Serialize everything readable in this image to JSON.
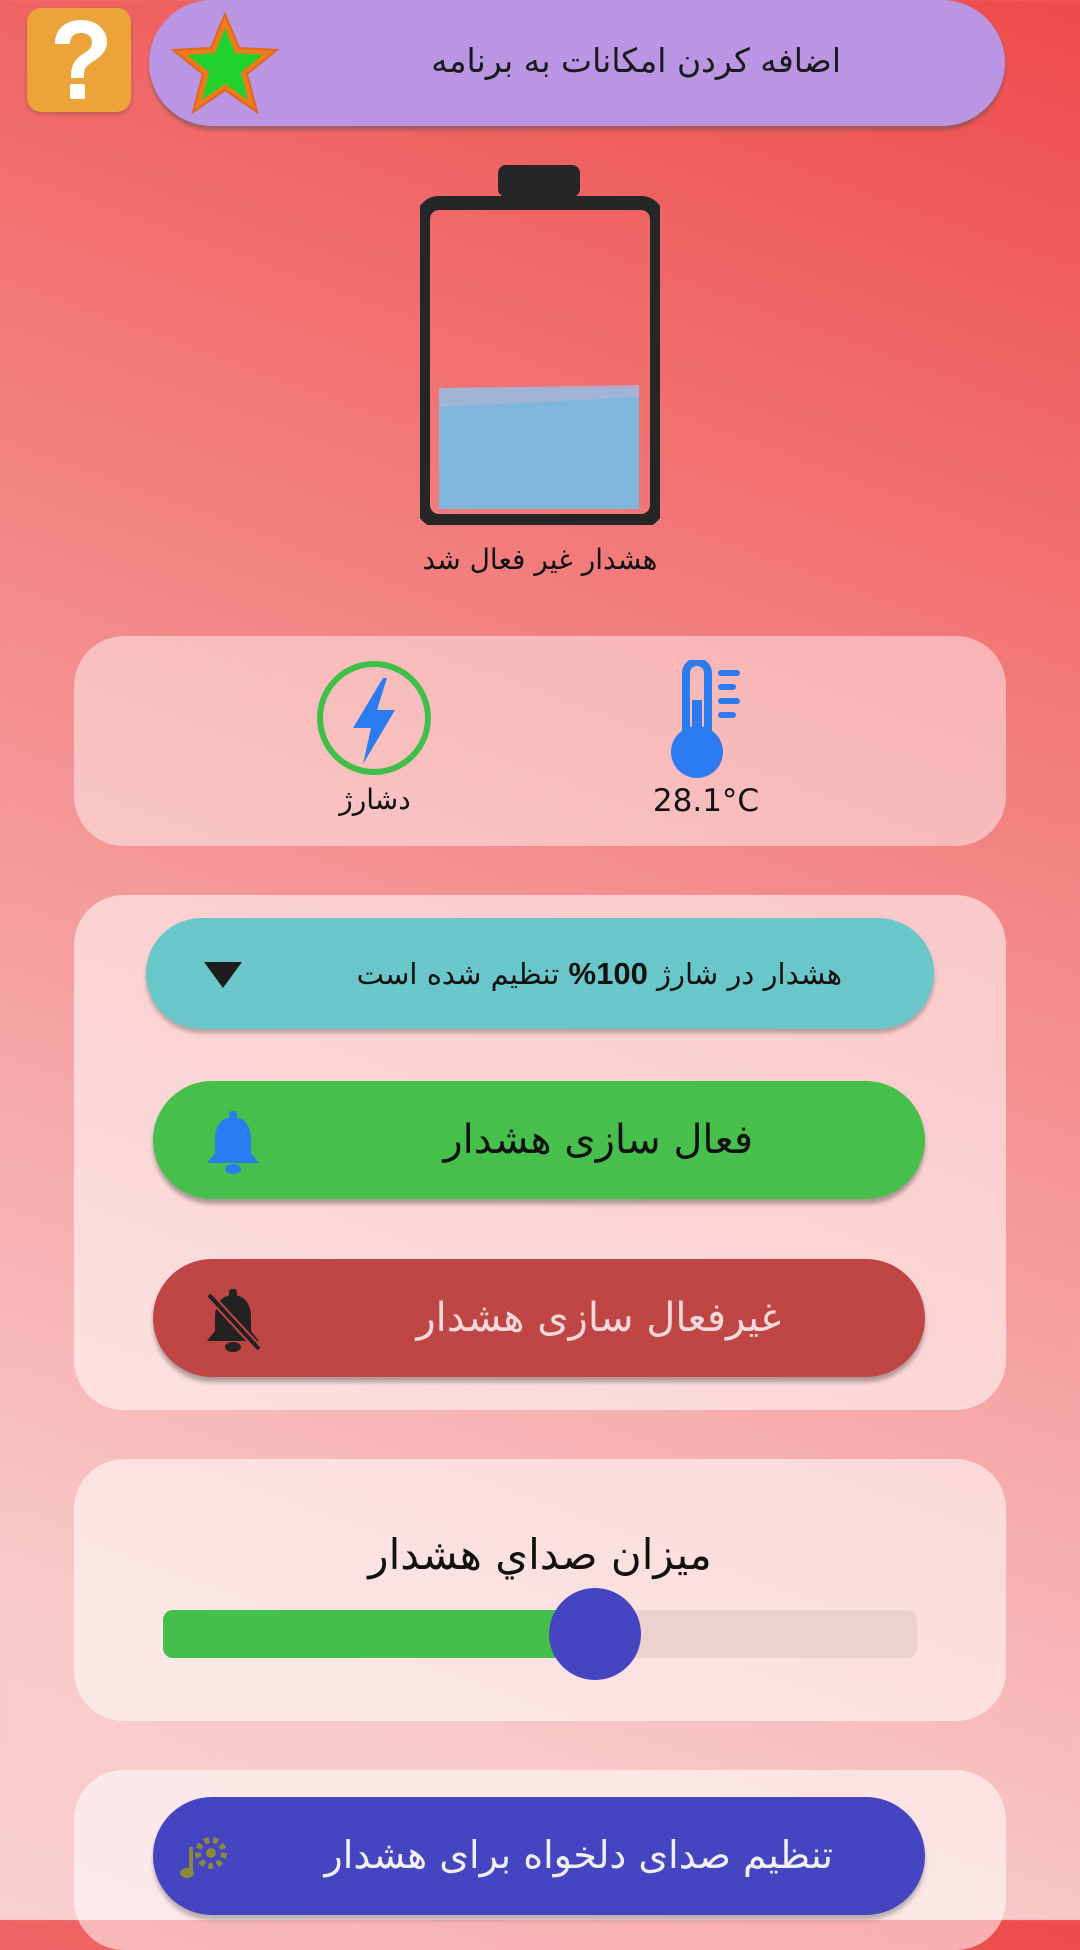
{
  "header": {
    "help_icon": "question-mark-icon",
    "features_icon": "star-icon",
    "features_label": "اضافه کردن امکانات به برنامه"
  },
  "battery": {
    "level_percent": 41,
    "status_text": "هشدار غیر فعال شد"
  },
  "info": {
    "charge_icon": "lightning-bolt-icon",
    "charge_label": "دشارژ",
    "temp_icon": "thermometer-icon",
    "temperature": "28.1°C"
  },
  "alarm": {
    "level_text_before": "هشدار در شارژ ",
    "level_value": "100%",
    "level_text_after": " تنظیم شده است",
    "enable_label": "فعال سازی هشدار",
    "disable_label": "غیرفعال سازی هشدار"
  },
  "volume": {
    "title": "ميزان صداي هشدار",
    "value_fraction": 0.6
  },
  "sound": {
    "label": "تنظیم صدای دلخواه برای هشدار",
    "icon": "music-gear-icon"
  },
  "colors": {
    "enable": "#46c04b",
    "disable": "#c04545",
    "select": "#6ac7c9",
    "sound": "#4545c1",
    "banner": "#b995e3"
  }
}
